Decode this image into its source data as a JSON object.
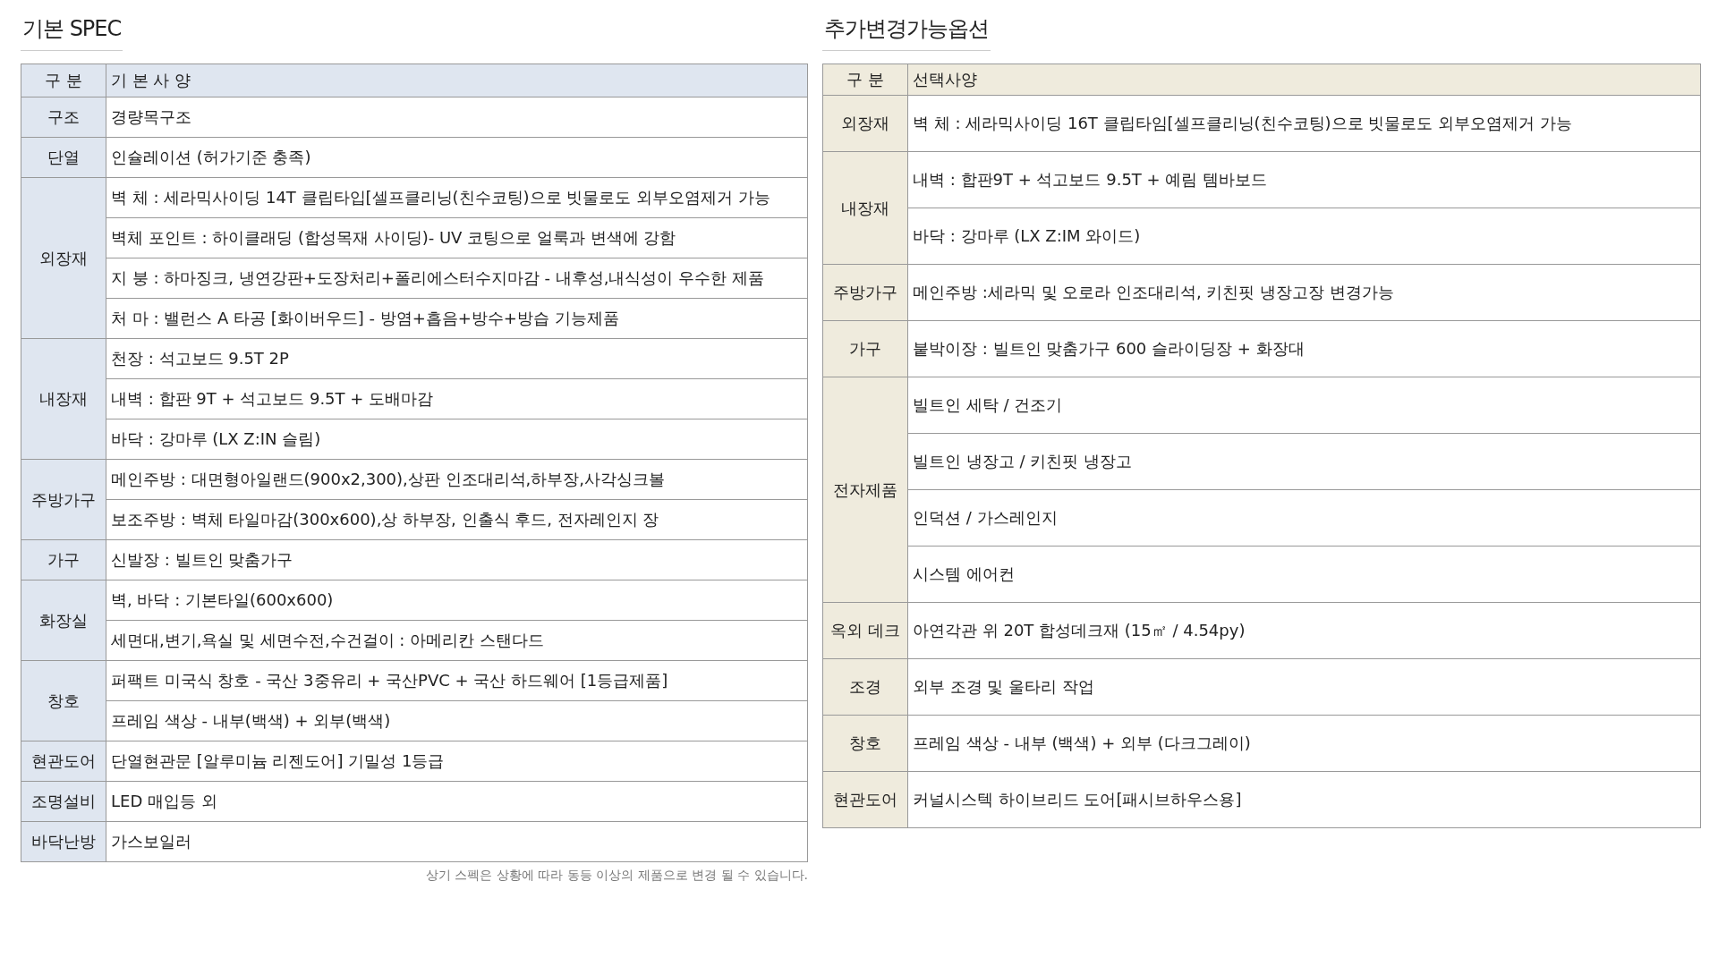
{
  "basic_spec": {
    "title": "기본 SPEC",
    "header": {
      "category": "구 분",
      "spec": "기 본 사 양"
    },
    "sections": [
      {
        "category": "구조",
        "items": [
          "경량목구조"
        ]
      },
      {
        "category": "단열",
        "items": [
          "인슐레이션 (허가기준 충족)"
        ]
      },
      {
        "category": "외장재",
        "items": [
          "벽 체 : 세라믹사이딩 14T 클립타입[셀프클리닝(친수코팅)으로 빗물로도 외부오염제거 가능",
          "벽체 포인트 : 하이클래딩 (합성목재 사이딩)- UV 코팅으로 얼룩과 변색에 강함",
          "지 붕 : 하마징크, 냉연강판+도장처리+폴리에스터수지마감 - 내후성,내식성이 우수한 제품",
          "처 마 : 밸런스 A 타공 [화이버우드] - 방염+흡음+방수+방습 기능제품"
        ]
      },
      {
        "category": "내장재",
        "items": [
          "천장 : 석고보드 9.5T 2P",
          "내벽 : 합판 9T + 석고보드 9.5T + 도배마감",
          "바닥 : 강마루 (LX Z:IN 슬림)"
        ]
      },
      {
        "category": "주방가구",
        "items": [
          "메인주방 : 대면형아일랜드(900x2,300),상판 인조대리석,하부장,사각싱크볼",
          "보조주방 : 벽체 타일마감(300x600),상 하부장, 인출식 후드, 전자레인지 장"
        ]
      },
      {
        "category": "가구",
        "items": [
          "신발장 : 빌트인 맞춤가구"
        ]
      },
      {
        "category": "화장실",
        "items": [
          "벽, 바닥 : 기본타일(600x600)",
          "세면대,변기,욕실 및 세면수전,수건걸이 : 아메리칸 스탠다드"
        ]
      },
      {
        "category": "창호",
        "items": [
          "퍼팩트 미국식 창호 - 국산 3중유리 + 국산PVC + 국산 하드웨어 [1등급제품]",
          "프레임 색상 - 내부(백색) + 외부(백색)"
        ]
      },
      {
        "category": "현관도어",
        "items": [
          "단열현관문 [알루미늄 리젠도어] 기밀성 1등급"
        ]
      },
      {
        "category": "조명설비",
        "items": [
          "LED 매입등 외"
        ]
      },
      {
        "category": "바닥난방",
        "items": [
          "가스보일러"
        ]
      }
    ],
    "footnote": "상기 스펙은 상황에 따라 동등 이상의 제품으로 변경 될 수 있습니다."
  },
  "options": {
    "title": "추가변경가능옵션",
    "header": {
      "category": "구 분",
      "spec": "선택사양"
    },
    "sections": [
      {
        "category": "외장재",
        "items": [
          "벽 체 : 세라믹사이딩 16T 클립타임[셀프클리닝(친수코팅)으로 빗물로도 외부오염제거 가능"
        ]
      },
      {
        "category": "내장재",
        "items": [
          "내벽 : 합판9T + 석고보드 9.5T + 예림 템바보드",
          "바닥 : 강마루 (LX Z:IM 와이드)"
        ]
      },
      {
        "category": "주방가구",
        "items": [
          "메인주방 :세라믹 및 오로라 인조대리석, 키친핏 냉장고장 변경가능"
        ]
      },
      {
        "category": "가구",
        "items": [
          "붙박이장 : 빌트인 맞춤가구 600 슬라이딩장 + 화장대"
        ]
      },
      {
        "category": "전자제품",
        "items": [
          "빌트인 세탁 / 건조기",
          "빌트인 냉장고 / 키친핏 냉장고",
          "인덕션 / 가스레인지",
          "시스템 에어컨"
        ]
      },
      {
        "category": "옥외 데크",
        "items": [
          "아연각관 위 20T 합성데크재 (15㎡ / 4.54py)"
        ]
      },
      {
        "category": "조경",
        "items": [
          "외부 조경 및 울타리 작업"
        ]
      },
      {
        "category": "창호",
        "items": [
          "프레임 색상 - 내부 (백색) + 외부 (다크그레이)"
        ]
      },
      {
        "category": "현관도어",
        "items": [
          "커널시스텍 하이브리드 도어[패시브하우스용]"
        ]
      }
    ]
  }
}
